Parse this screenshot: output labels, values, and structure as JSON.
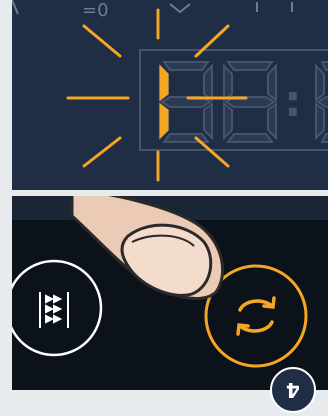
{
  "display": {
    "top_label": "=0",
    "colon": ":",
    "active_segment_color": "#f5a623",
    "inactive_segment_color": "#46536a"
  },
  "buttons": {
    "left_icon": "program-stream-icon",
    "right_icon": "sync-rotate-icon",
    "right_ring_color": "#f5a623",
    "left_ring_color": "#ffffff"
  },
  "step": {
    "label": "4"
  }
}
